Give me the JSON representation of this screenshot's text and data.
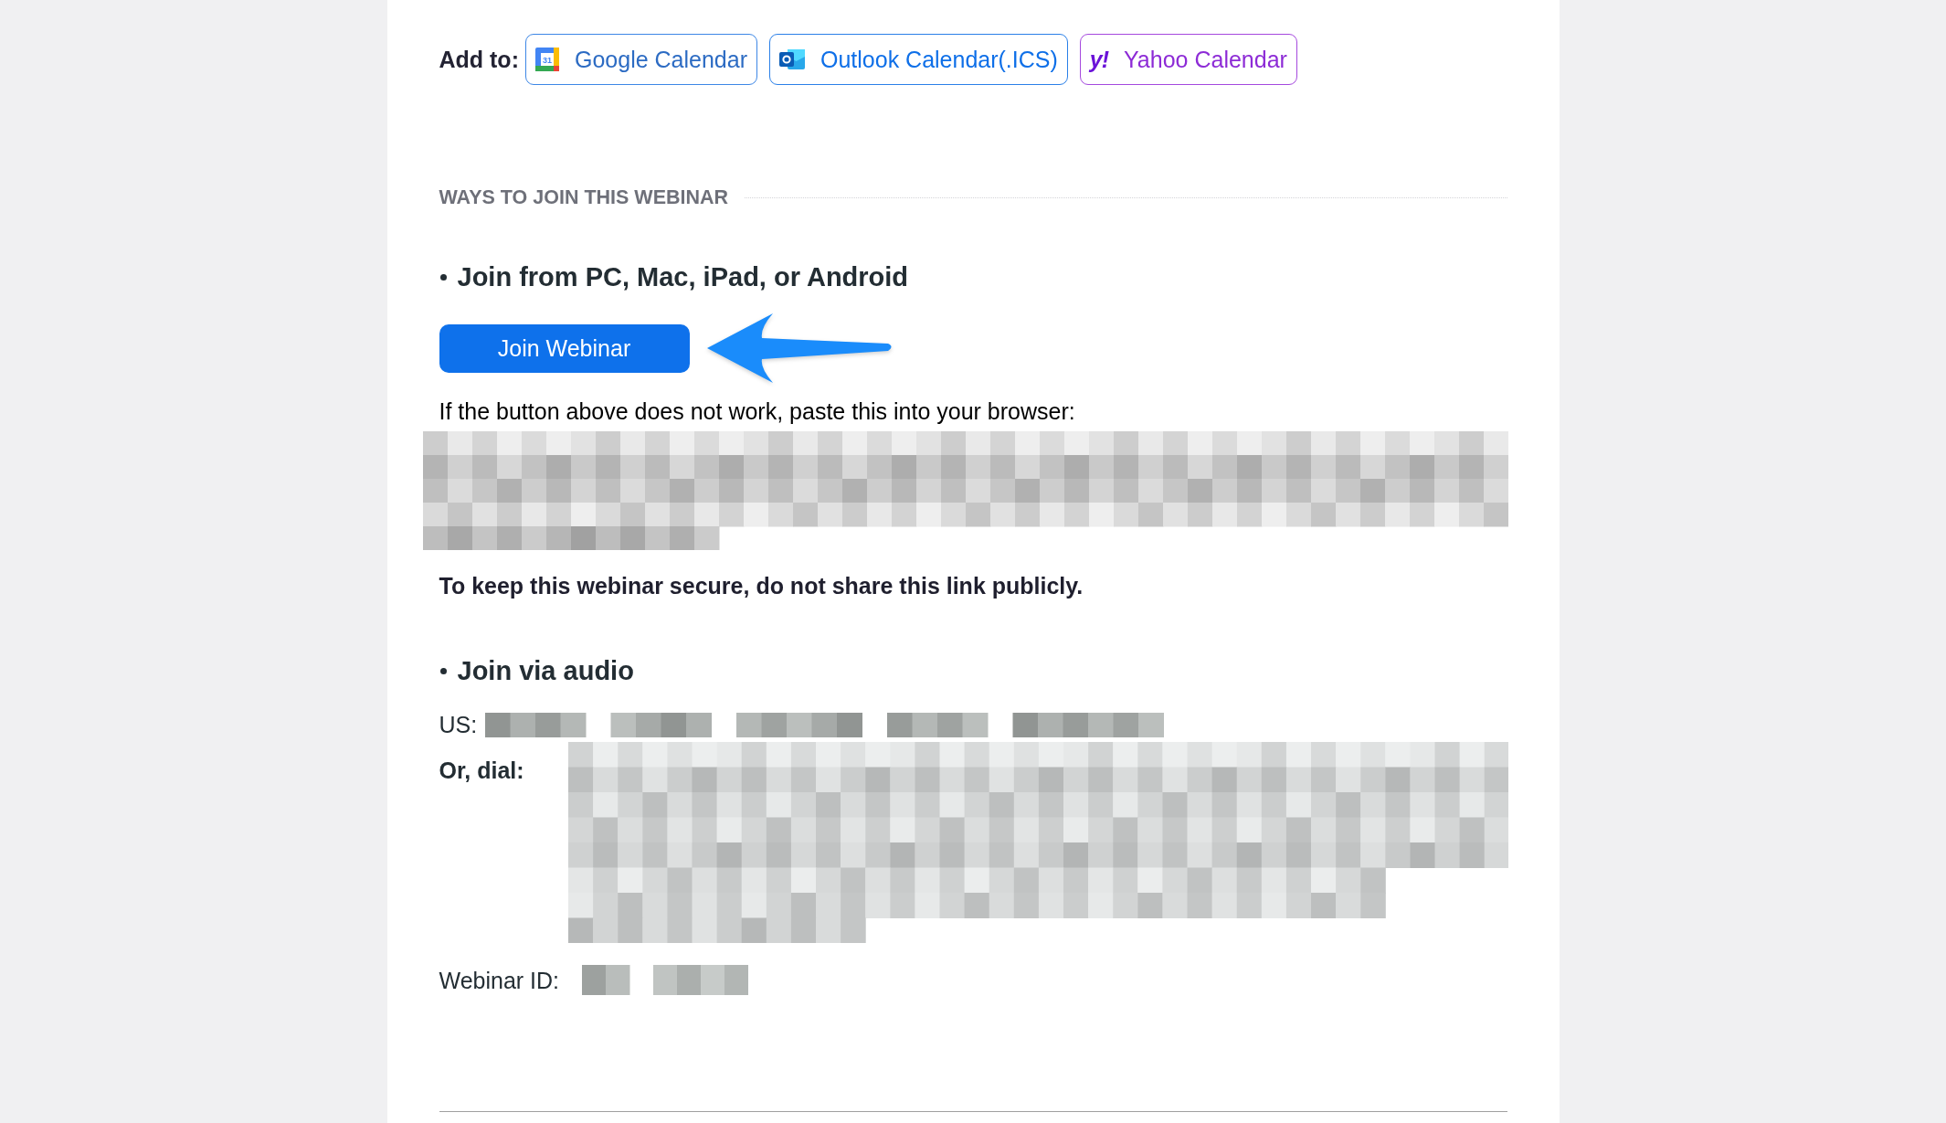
{
  "add_to": {
    "label": "Add to:",
    "calendars": [
      {
        "kind": "google",
        "label": "Google Calendar",
        "icon_text": "31"
      },
      {
        "kind": "outlook",
        "label": "Outlook Calendar(.ICS)"
      },
      {
        "kind": "yahoo",
        "label": "Yahoo Calendar",
        "icon_text": "y!"
      }
    ]
  },
  "section_heading": "WAYS TO JOIN THIS WEBINAR",
  "join_options": [
    {
      "kind": "web",
      "title": "Join from PC, Mac, iPad, or Android",
      "button": "Join Webinar",
      "fallback": "If the button above does not work, paste this into your browser:",
      "notice": "To keep this webinar secure, do not share this link publicly."
    },
    {
      "kind": "audio",
      "title": "Join via audio",
      "rows": [
        {
          "kind": "phone",
          "label": "US:"
        },
        {
          "kind": "dial_list",
          "label": "Or, dial:"
        },
        {
          "kind": "id",
          "label": "Webinar ID:"
        }
      ]
    }
  ]
}
